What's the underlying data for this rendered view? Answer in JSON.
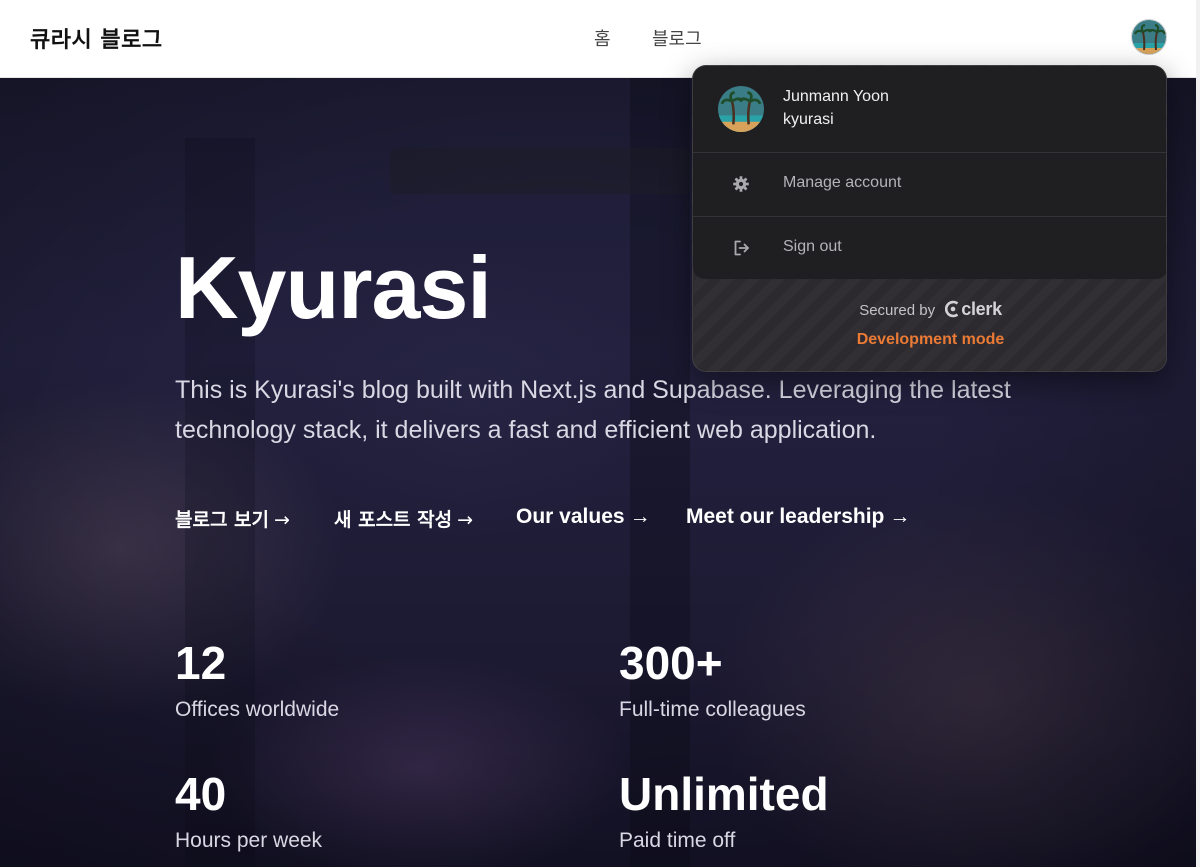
{
  "header": {
    "brand": "큐라시 블로그",
    "nav": [
      {
        "label": "홈"
      },
      {
        "label": "블로그"
      }
    ]
  },
  "hero": {
    "title": "Kyurasi",
    "description": "This is Kyurasi's blog built with Next.js and Supabase. Leveraging the latest technology stack, it delivers a fast and efficient web application.",
    "links": [
      {
        "label": "블로그 보기",
        "arrow": "→"
      },
      {
        "label": "새 포스트 작성",
        "arrow": "→"
      },
      {
        "label": "Our values",
        "arrow": "→"
      },
      {
        "label": "Meet our leadership",
        "arrow": "→"
      }
    ],
    "stats": [
      {
        "value": "12",
        "label": "Offices worldwide"
      },
      {
        "value": "300+",
        "label": "Full-time colleagues"
      },
      {
        "value": "40",
        "label": "Hours per week"
      },
      {
        "value": "Unlimited",
        "label": "Paid time off"
      }
    ]
  },
  "user_menu": {
    "name": "Junmann Yoon",
    "username": "kyurasi",
    "avatar_icon": "palm-tree-avatar-icon",
    "items": [
      {
        "label": "Manage account",
        "icon": "gear-icon"
      },
      {
        "label": "Sign out",
        "icon": "sign-out-icon"
      }
    ],
    "secured_by": "Secured by",
    "provider": "clerk",
    "dev_mode": "Development mode"
  },
  "colors": {
    "dev_mode": "#ea7a34",
    "hero_bg": "#1d1c35",
    "menu_bg": "#1f1f22"
  }
}
